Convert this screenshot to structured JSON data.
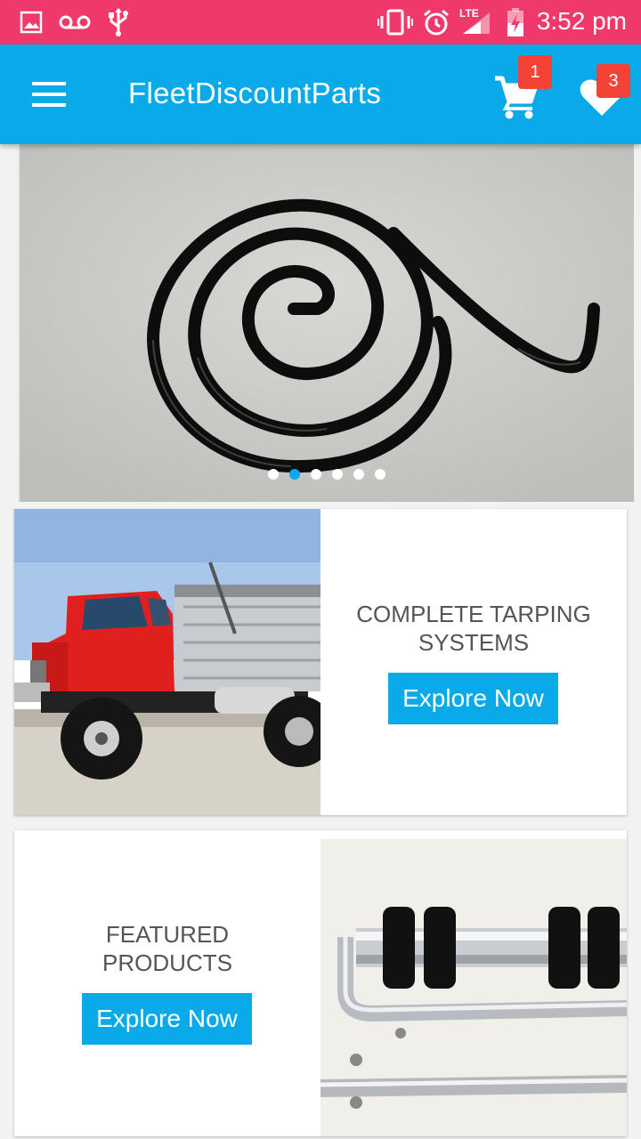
{
  "status_bar": {
    "time": "3:52 pm",
    "network": "LTE",
    "icons": [
      "image-icon",
      "voicemail-icon",
      "usb-icon",
      "vibrate-icon",
      "alarm-icon",
      "signal-icon",
      "battery-charging-icon"
    ]
  },
  "app_bar": {
    "title": "FleetDiscountParts",
    "menu_icon": "hamburger-menu-icon",
    "cart_icon": "shopping-cart-icon",
    "cart_count": "1",
    "wishlist_icon": "heart-icon",
    "wishlist_count": "3"
  },
  "carousel": {
    "image": "black coiled spring",
    "slide_count": 6,
    "active_index": 1
  },
  "cards": [
    {
      "title_line1": "COMPLETE TARPING",
      "title_line2": "SYSTEMS",
      "button": "Explore Now",
      "image": "red dump truck"
    },
    {
      "title_line1": "FEATURED",
      "title_line2": "PRODUCTS",
      "button": "Explore Now",
      "image": "tarp roller tubes and arms"
    }
  ],
  "colors": {
    "status_bar": "#f0396b",
    "app_bar": "#0aaae9",
    "badge": "#f44336",
    "button": "#0aaae9"
  }
}
